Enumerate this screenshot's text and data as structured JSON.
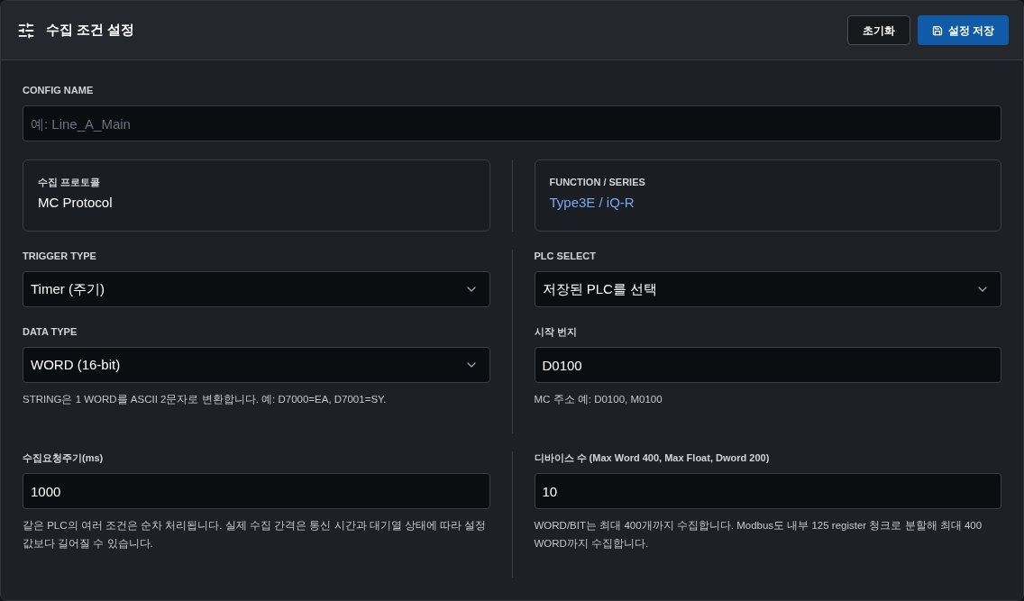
{
  "header": {
    "title": "수집 조건 설정",
    "buttons": [
      {
        "label": "초기화",
        "kind": "secondary"
      },
      {
        "label": "설정 저장",
        "kind": "primary"
      }
    ]
  },
  "config_name": {
    "kind": "input",
    "label": "CONFIG NAME",
    "placeholder": "예: Line_A_Main"
  },
  "groups": [
    {
      "left": [
        {
          "kind": "card",
          "label": "수집 프로토콜",
          "value": "MC Protocol",
          "accent": false
        }
      ],
      "right": [
        {
          "kind": "card",
          "label": "FUNCTION / SERIES",
          "value": "Type3E / iQ-R",
          "accent": true
        }
      ]
    },
    {
      "left": [
        {
          "kind": "select",
          "label": "TRIGGER TYPE",
          "value": "Timer (주기)"
        },
        {
          "kind": "select",
          "label": "DATA TYPE",
          "value": "WORD (16-bit)",
          "help": "STRING은 1 WORD를 ASCII 2문자로 변환합니다. 예: D7000=EA, D7001=SY."
        }
      ],
      "right": [
        {
          "kind": "select",
          "label": "PLC SELECT",
          "value": "저장된 PLC를 선택"
        },
        {
          "kind": "input",
          "label": "시작 번지",
          "value": "D0100",
          "help": "MC 주소 예: D0100, M0100"
        }
      ]
    },
    {
      "left": [
        {
          "kind": "input",
          "label": "수집요청주기(ms)",
          "value": "1000",
          "help": "같은 PLC의 여러 조건은 순차 처리됩니다. 실제 수집 간격은 통신 시간과 대기열 상태에 따라 설정값보다 길어질 수 있습니다."
        }
      ],
      "right": [
        {
          "kind": "input",
          "label": "디바이스 수 (Max Word 400, Max Float, Dword 200)",
          "value": "10",
          "help": "WORD/BIT는 최대 400개까지 수집합니다. Modbus도 내부 125 register 청크로 분할해 최대 400 WORD까지 수집합니다."
        }
      ]
    }
  ]
}
